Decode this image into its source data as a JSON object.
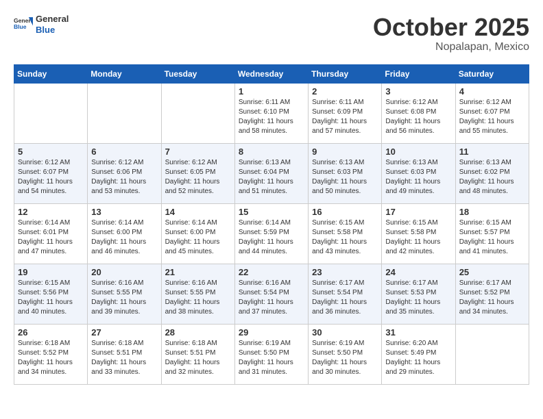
{
  "header": {
    "logo_line1": "General",
    "logo_line2": "Blue",
    "month": "October 2025",
    "location": "Nopalapan, Mexico"
  },
  "weekdays": [
    "Sunday",
    "Monday",
    "Tuesday",
    "Wednesday",
    "Thursday",
    "Friday",
    "Saturday"
  ],
  "weeks": [
    [
      {
        "day": "",
        "empty": true
      },
      {
        "day": "",
        "empty": true
      },
      {
        "day": "",
        "empty": true
      },
      {
        "day": "1",
        "sunrise": "6:11 AM",
        "sunset": "6:10 PM",
        "daylight": "11 hours and 58 minutes."
      },
      {
        "day": "2",
        "sunrise": "6:11 AM",
        "sunset": "6:09 PM",
        "daylight": "11 hours and 57 minutes."
      },
      {
        "day": "3",
        "sunrise": "6:12 AM",
        "sunset": "6:08 PM",
        "daylight": "11 hours and 56 minutes."
      },
      {
        "day": "4",
        "sunrise": "6:12 AM",
        "sunset": "6:07 PM",
        "daylight": "11 hours and 55 minutes."
      }
    ],
    [
      {
        "day": "5",
        "sunrise": "6:12 AM",
        "sunset": "6:07 PM",
        "daylight": "11 hours and 54 minutes."
      },
      {
        "day": "6",
        "sunrise": "6:12 AM",
        "sunset": "6:06 PM",
        "daylight": "11 hours and 53 minutes."
      },
      {
        "day": "7",
        "sunrise": "6:12 AM",
        "sunset": "6:05 PM",
        "daylight": "11 hours and 52 minutes."
      },
      {
        "day": "8",
        "sunrise": "6:13 AM",
        "sunset": "6:04 PM",
        "daylight": "11 hours and 51 minutes."
      },
      {
        "day": "9",
        "sunrise": "6:13 AM",
        "sunset": "6:03 PM",
        "daylight": "11 hours and 50 minutes."
      },
      {
        "day": "10",
        "sunrise": "6:13 AM",
        "sunset": "6:03 PM",
        "daylight": "11 hours and 49 minutes."
      },
      {
        "day": "11",
        "sunrise": "6:13 AM",
        "sunset": "6:02 PM",
        "daylight": "11 hours and 48 minutes."
      }
    ],
    [
      {
        "day": "12",
        "sunrise": "6:14 AM",
        "sunset": "6:01 PM",
        "daylight": "11 hours and 47 minutes."
      },
      {
        "day": "13",
        "sunrise": "6:14 AM",
        "sunset": "6:00 PM",
        "daylight": "11 hours and 46 minutes."
      },
      {
        "day": "14",
        "sunrise": "6:14 AM",
        "sunset": "6:00 PM",
        "daylight": "11 hours and 45 minutes."
      },
      {
        "day": "15",
        "sunrise": "6:14 AM",
        "sunset": "5:59 PM",
        "daylight": "11 hours and 44 minutes."
      },
      {
        "day": "16",
        "sunrise": "6:15 AM",
        "sunset": "5:58 PM",
        "daylight": "11 hours and 43 minutes."
      },
      {
        "day": "17",
        "sunrise": "6:15 AM",
        "sunset": "5:58 PM",
        "daylight": "11 hours and 42 minutes."
      },
      {
        "day": "18",
        "sunrise": "6:15 AM",
        "sunset": "5:57 PM",
        "daylight": "11 hours and 41 minutes."
      }
    ],
    [
      {
        "day": "19",
        "sunrise": "6:15 AM",
        "sunset": "5:56 PM",
        "daylight": "11 hours and 40 minutes."
      },
      {
        "day": "20",
        "sunrise": "6:16 AM",
        "sunset": "5:55 PM",
        "daylight": "11 hours and 39 minutes."
      },
      {
        "day": "21",
        "sunrise": "6:16 AM",
        "sunset": "5:55 PM",
        "daylight": "11 hours and 38 minutes."
      },
      {
        "day": "22",
        "sunrise": "6:16 AM",
        "sunset": "5:54 PM",
        "daylight": "11 hours and 37 minutes."
      },
      {
        "day": "23",
        "sunrise": "6:17 AM",
        "sunset": "5:54 PM",
        "daylight": "11 hours and 36 minutes."
      },
      {
        "day": "24",
        "sunrise": "6:17 AM",
        "sunset": "5:53 PM",
        "daylight": "11 hours and 35 minutes."
      },
      {
        "day": "25",
        "sunrise": "6:17 AM",
        "sunset": "5:52 PM",
        "daylight": "11 hours and 34 minutes."
      }
    ],
    [
      {
        "day": "26",
        "sunrise": "6:18 AM",
        "sunset": "5:52 PM",
        "daylight": "11 hours and 34 minutes."
      },
      {
        "day": "27",
        "sunrise": "6:18 AM",
        "sunset": "5:51 PM",
        "daylight": "11 hours and 33 minutes."
      },
      {
        "day": "28",
        "sunrise": "6:18 AM",
        "sunset": "5:51 PM",
        "daylight": "11 hours and 32 minutes."
      },
      {
        "day": "29",
        "sunrise": "6:19 AM",
        "sunset": "5:50 PM",
        "daylight": "11 hours and 31 minutes."
      },
      {
        "day": "30",
        "sunrise": "6:19 AM",
        "sunset": "5:50 PM",
        "daylight": "11 hours and 30 minutes."
      },
      {
        "day": "31",
        "sunrise": "6:20 AM",
        "sunset": "5:49 PM",
        "daylight": "11 hours and 29 minutes."
      },
      {
        "day": "",
        "empty": true
      }
    ]
  ],
  "labels": {
    "sunrise": "Sunrise:",
    "sunset": "Sunset:",
    "daylight": "Daylight:"
  }
}
